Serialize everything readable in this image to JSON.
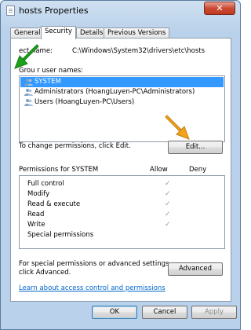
{
  "window": {
    "title": "hosts Properties",
    "close_label": "✕"
  },
  "tabs": [
    {
      "label": "General"
    },
    {
      "label": "Security"
    },
    {
      "label": "Details"
    },
    {
      "label": "Previous Versions"
    }
  ],
  "security": {
    "object_name_label": "ect name:",
    "object_name_value": "C:\\Windows\\System32\\drivers\\etc\\hosts",
    "groups_label": "Grou  r user names:",
    "groups": [
      {
        "name": "SYSTEM",
        "selected": true
      },
      {
        "name": "Administrators (HoangLuyen-PC\\Administrators)",
        "selected": false
      },
      {
        "name": "Users (HoangLuyen-PC\\Users)",
        "selected": false
      }
    ],
    "edit_text": "To change permissions, click Edit.",
    "edit_button": "Edit...",
    "permissions_label": "Permissions for SYSTEM",
    "allow_label": "Allow",
    "deny_label": "Deny",
    "permissions": [
      {
        "name": "Full control",
        "allow": "✓",
        "deny": ""
      },
      {
        "name": "Modify",
        "allow": "✓",
        "deny": ""
      },
      {
        "name": "Read & execute",
        "allow": "✓",
        "deny": ""
      },
      {
        "name": "Read",
        "allow": "✓",
        "deny": ""
      },
      {
        "name": "Write",
        "allow": "✓",
        "deny": ""
      },
      {
        "name": "Special permissions",
        "allow": "",
        "deny": ""
      }
    ],
    "special_text": "For special permissions or advanced settings, click Advanced.",
    "advanced_button": "Advanced",
    "learn_link": "Learn about access control and permissions"
  },
  "buttons": {
    "ok": "OK",
    "cancel": "Cancel",
    "apply": "Apply"
  },
  "colors": {
    "selection": "#3399ff",
    "green_arrow": "#1aa31a",
    "orange_arrow": "#f2a31b"
  }
}
